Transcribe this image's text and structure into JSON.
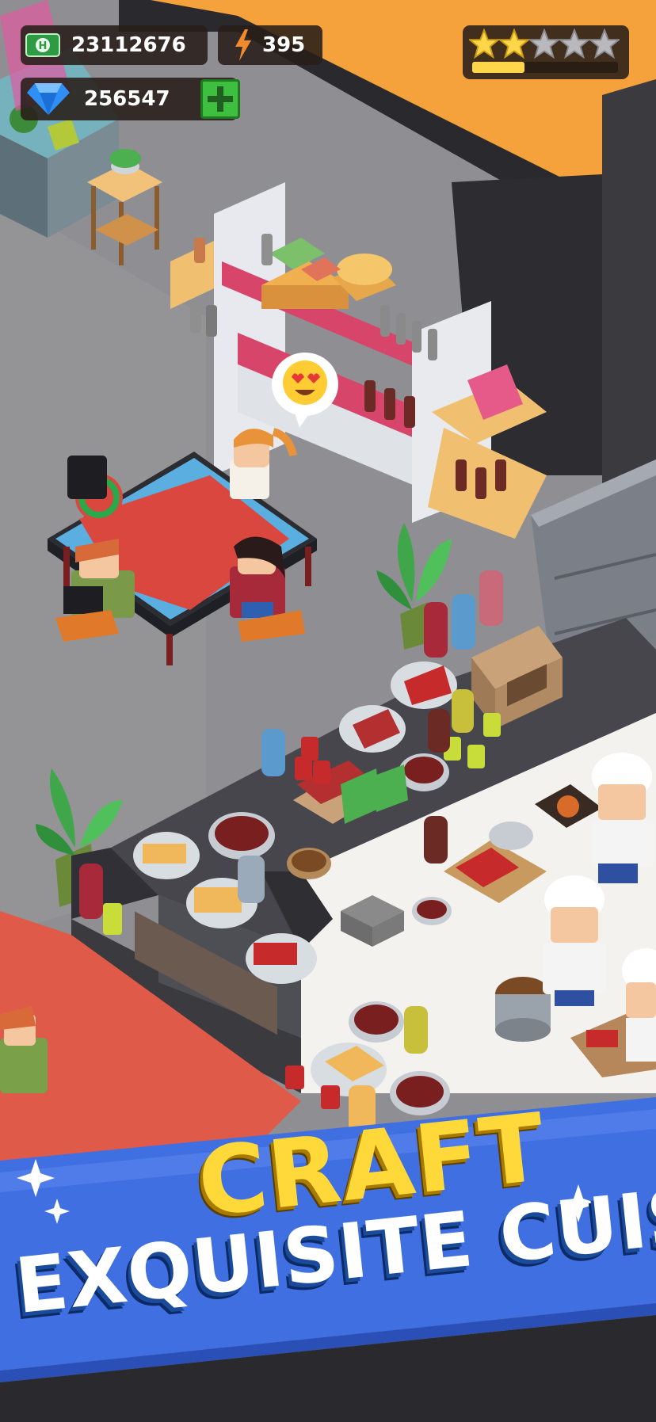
{
  "hud": {
    "cash": {
      "value": "23112676",
      "icon": "cash-icon"
    },
    "energy": {
      "value": "395",
      "icon": "lightning-icon"
    },
    "gems": {
      "value": "256547",
      "icon": "diamond-icon",
      "add_icon": "plus-icon"
    },
    "rating": {
      "stars_filled": 2,
      "stars_total": 5,
      "progress_fraction": 0.36
    }
  },
  "scene": {
    "speech_bubble_icon": "heart-eyes-emoji-icon",
    "customer_timer_fraction": 0.75
  },
  "banner": {
    "line1": "CRAFT",
    "line2": "EXQUISITE CUISINE"
  },
  "colors": {
    "banner_blue": "#3f6fe0",
    "craft_yellow": "#ffd93a",
    "floor_gray": "#8e8e91",
    "wall_orange": "#f6a23c",
    "rug_red": "#d9473f",
    "shelf_pink": "#d8456a",
    "counter_dark": "#4a4a4f",
    "gem_blue": "#2f8ff5",
    "plus_green": "#3fbf3f"
  }
}
